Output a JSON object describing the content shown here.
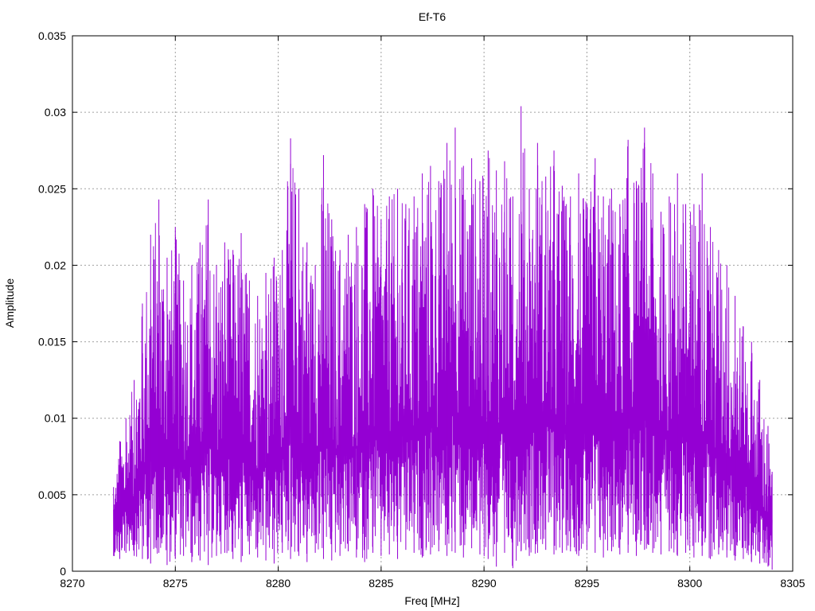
{
  "chart_data": {
    "type": "line",
    "title": "Ef-T6",
    "xlabel": "Freq [MHz]",
    "ylabel": "Amplitude",
    "xlim": [
      8270,
      8305
    ],
    "ylim": [
      0,
      0.035
    ],
    "grid": true,
    "x_ticks": [
      "8270",
      "8275",
      "8280",
      "8285",
      "8290",
      "8295",
      "8300",
      "8305"
    ],
    "y_ticks": [
      "0",
      "0.005",
      "0.01",
      "0.015",
      "0.02",
      "0.025",
      "0.03",
      "0.035"
    ],
    "series_color": "#9400d3",
    "series": [
      {
        "x": [
          8272.0,
          8272.3,
          8272.6,
          8273.0,
          8273.4,
          8273.8,
          8274.2,
          8274.6,
          8275.0,
          8275.4,
          8275.8,
          8276.2,
          8276.6,
          8277.0,
          8277.4,
          8277.8,
          8278.2,
          8278.6,
          8279.0,
          8279.4,
          8279.8,
          8280.2,
          8280.6,
          8281.0,
          8281.4,
          8281.8,
          8282.2,
          8282.6,
          8283.0,
          8283.4,
          8283.8,
          8284.2,
          8284.6,
          8285.0,
          8285.4,
          8285.8,
          8286.2,
          8286.6,
          8287.0,
          8287.4,
          8287.8,
          8288.2,
          8288.6,
          8289.0,
          8289.4,
          8289.8,
          8290.2,
          8290.6,
          8291.0,
          8291.4,
          8291.8,
          8292.2,
          8292.6,
          8293.0,
          8293.4,
          8293.8,
          8294.2,
          8294.6,
          8295.0,
          8295.4,
          8295.8,
          8296.2,
          8296.6,
          8297.0,
          8297.4,
          8297.8,
          8298.2,
          8298.6,
          8299.0,
          8299.4,
          8299.8,
          8300.2,
          8300.6,
          8301.0,
          8301.4,
          8301.8,
          8302.2,
          8302.6,
          8303.0,
          8303.4,
          8303.8,
          8304.0
        ],
        "y_max": [
          0.0055,
          0.0085,
          0.01,
          0.0125,
          0.0175,
          0.022,
          0.0243,
          0.0205,
          0.0225,
          0.019,
          0.02,
          0.0215,
          0.0243,
          0.02,
          0.0215,
          0.021,
          0.0221,
          0.019,
          0.018,
          0.0195,
          0.0205,
          0.021,
          0.0283,
          0.025,
          0.0215,
          0.02,
          0.0272,
          0.023,
          0.021,
          0.022,
          0.0225,
          0.024,
          0.025,
          0.023,
          0.0245,
          0.025,
          0.024,
          0.0245,
          0.026,
          0.0265,
          0.0255,
          0.028,
          0.029,
          0.0265,
          0.027,
          0.0255,
          0.0275,
          0.0262,
          0.0268,
          0.0245,
          0.0304,
          0.025,
          0.028,
          0.0258,
          0.0275,
          0.0252,
          0.0245,
          0.026,
          0.024,
          0.027,
          0.0245,
          0.025,
          0.024,
          0.0282,
          0.0255,
          0.029,
          0.026,
          0.0235,
          0.0245,
          0.026,
          0.024,
          0.024,
          0.026,
          0.0225,
          0.021,
          0.02,
          0.018,
          0.016,
          0.015,
          0.0125,
          0.0095,
          0.0065
        ],
        "y_min": [
          0.001,
          0.0008,
          0.0012,
          0.001,
          0.0008,
          0.0005,
          0.0012,
          0.0004,
          0.0008,
          0.001,
          0.0006,
          0.0007,
          0.0004,
          0.001,
          0.0012,
          0.0008,
          0.0006,
          0.0011,
          0.0009,
          0.0007,
          0.0005,
          0.0012,
          0.0008,
          0.001,
          0.0006,
          0.0012,
          0.0008,
          0.0007,
          0.001,
          0.0013,
          0.0009,
          0.0006,
          0.0012,
          0.001,
          0.0011,
          0.0008,
          0.0014,
          0.0012,
          0.0009,
          0.0011,
          0.0013,
          0.001,
          0.0012,
          0.0009,
          0.0015,
          0.0011,
          0.0008,
          0.0003,
          0.0012,
          0.0002,
          0.0013,
          0.001,
          0.0012,
          0.0014,
          0.0011,
          0.0012,
          0.0013,
          0.001,
          0.0014,
          0.0012,
          0.0009,
          0.0013,
          0.0011,
          0.0012,
          0.001,
          0.0014,
          0.0012,
          0.0011,
          0.0013,
          0.001,
          0.0012,
          0.0009,
          0.001,
          0.0008,
          0.0011,
          0.0009,
          0.0007,
          0.0008,
          0.0006,
          0.0005,
          0.0003,
          0.0001
        ]
      }
    ]
  }
}
